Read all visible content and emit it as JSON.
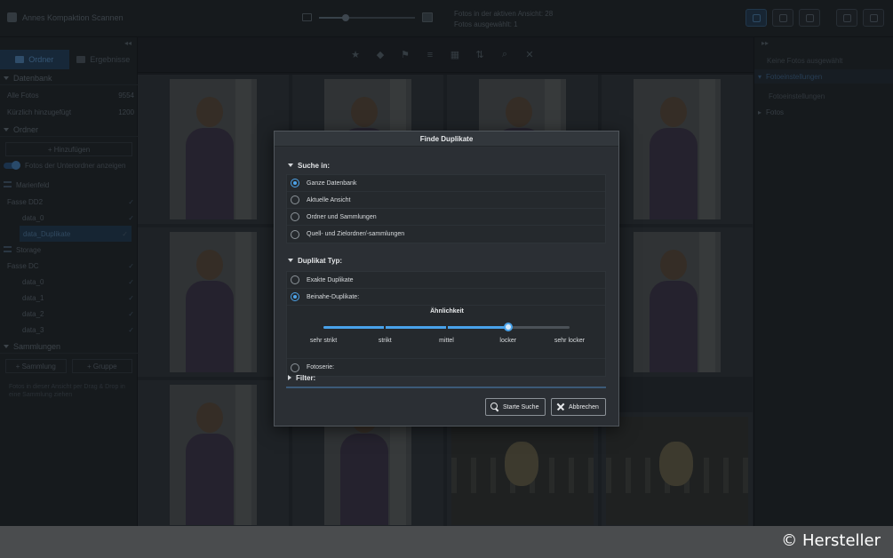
{
  "app": {
    "title": "Annes Kompaktion Scannen"
  },
  "topbar": {
    "info_line1": "Fotos in der aktiven Ansicht: 28",
    "info_line2": "Fotos ausgewählt: 1"
  },
  "sidebar": {
    "tabs": [
      {
        "label": "Ordner"
      },
      {
        "label": "Ergebnisse"
      }
    ],
    "datenbank": {
      "title": "Datenbank",
      "rows": [
        {
          "label": "Alle Fotos",
          "count": "9554"
        },
        {
          "label": "Kürzlich hinzugefügt",
          "count": "1200"
        }
      ]
    },
    "ordner": {
      "title": "Ordner",
      "add_label": "+ Hinzufügen",
      "toggle_label": "Fotos der Unterordner anzeigen"
    },
    "tree": [
      {
        "label": "Marienfeld",
        "checked": false
      },
      {
        "label": "Fasse DD2",
        "checked": true
      },
      {
        "label": "data_0",
        "checked": true
      },
      {
        "label": "data_Duplikate",
        "checked": true
      },
      {
        "label": "Storage",
        "checked": false
      },
      {
        "label": "Fasse DC",
        "checked": true
      },
      {
        "label": "data_0",
        "checked": true
      },
      {
        "label": "data_1",
        "checked": true
      },
      {
        "label": "data_2",
        "checked": true
      },
      {
        "label": "data_3",
        "checked": true
      }
    ],
    "sammlungen": {
      "title": "Sammlungen",
      "add_collection": "+ Sammlung",
      "add_group": "+ Gruppe",
      "hint": "Fotos in dieser Ansicht per Drag & Drop in eine Sammlung ziehen"
    }
  },
  "rightpanel": {
    "r1": "Keine Fotos ausgewählt",
    "r2": "Fotoeinstellungen",
    "r3": "Fotoeinstellungen",
    "r4": "Fotos"
  },
  "dialog": {
    "title": "Finde Duplikate",
    "search_in": {
      "title": "Suche in:",
      "options": [
        "Ganze Datenbank",
        "Aktuelle Ansicht",
        "Ordner und Sammlungen",
        "Quell- und Zielordner/-sammlungen"
      ],
      "selected_index": 0
    },
    "dup_type": {
      "title": "Duplikat Typ:",
      "option_exact": "Exakte Duplikate",
      "option_near": "Beinahe-Duplikate:",
      "option_series": "Fotoserie:",
      "selected": "near",
      "similarity": {
        "title": "Ähnlichkeit",
        "labels": [
          "sehr strikt",
          "strikt",
          "mittel",
          "locker",
          "sehr locker"
        ],
        "value_index": 3
      }
    },
    "filter": {
      "title": "Filter:"
    },
    "buttons": {
      "start": "Starte Suche",
      "cancel": "Abbrechen"
    }
  },
  "credit": "© Hersteller",
  "colors": {
    "accent": "#4da3e8",
    "dialog_bg": "#2b2f34",
    "footer": "#4a4c4e"
  }
}
